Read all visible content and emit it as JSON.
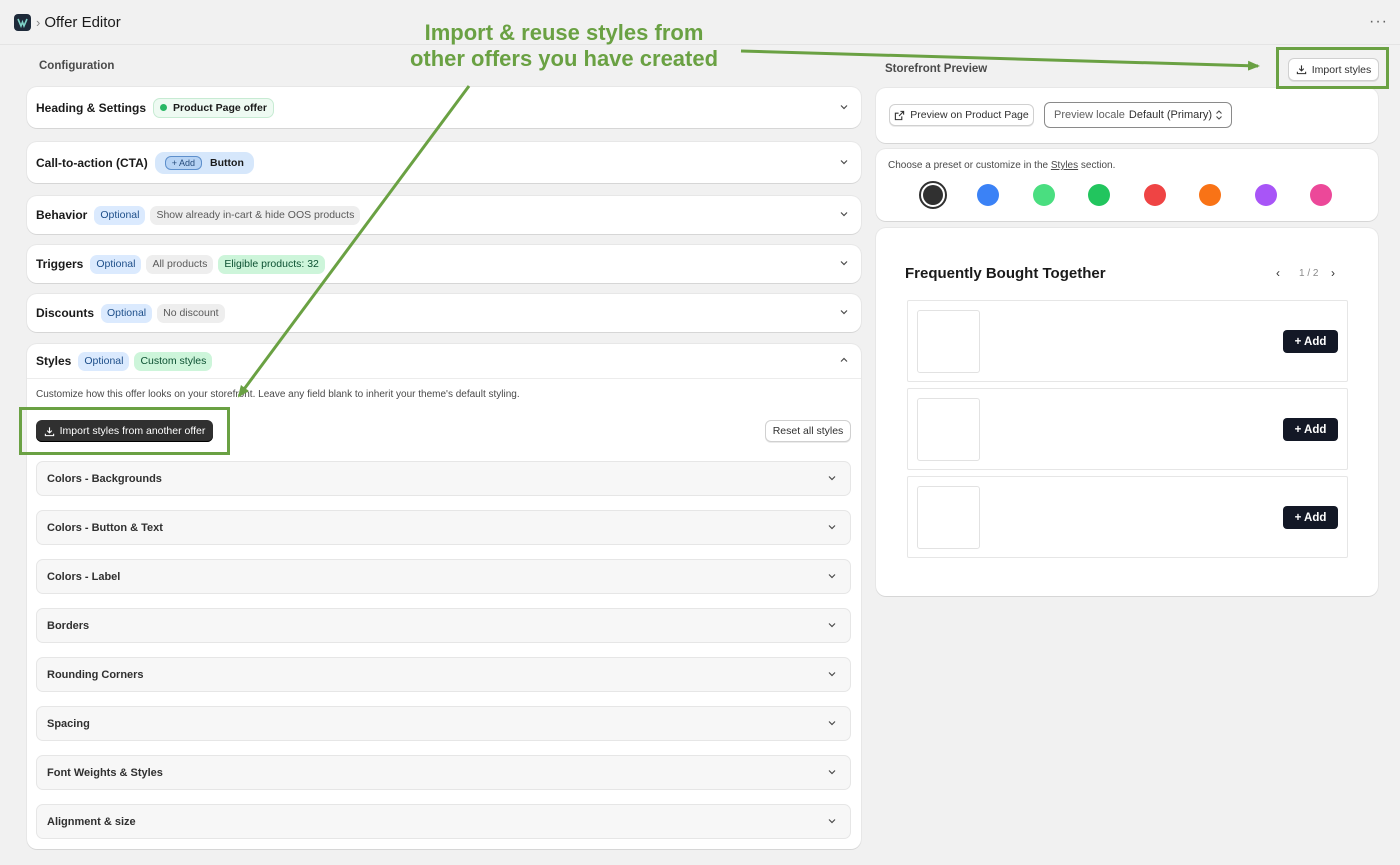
{
  "header": {
    "title": "Offer Editor",
    "separator": "›",
    "more": "···"
  },
  "annotation": {
    "line1": "Import & reuse styles from",
    "line2": "other offers you have created"
  },
  "config": {
    "title": "Configuration",
    "sections": {
      "heading": {
        "label": "Heading & Settings",
        "badge": "Product Page offer"
      },
      "cta": {
        "label": "Call-to-action (CTA)",
        "mini": "+ Add",
        "badge": "Button"
      },
      "behavior": {
        "label": "Behavior",
        "optional": "Optional",
        "detail": "Show already in-cart & hide OOS products"
      },
      "triggers": {
        "label": "Triggers",
        "optional": "Optional",
        "detail": "All products",
        "eligible": "Eligible products: 32"
      },
      "discounts": {
        "label": "Discounts",
        "optional": "Optional",
        "detail": "No discount"
      },
      "styles": {
        "label": "Styles",
        "optional": "Optional",
        "custom": "Custom styles",
        "description": "Customize how this offer looks on your storefront. Leave any field blank to inherit your theme's default styling.",
        "import_button": "Import styles from another offer",
        "reset_button": "Reset all styles",
        "subsections": [
          "Colors - Backgrounds",
          "Colors - Button & Text",
          "Colors - Label",
          "Borders",
          "Rounding Corners",
          "Spacing",
          "Font Weights & Styles",
          "Alignment & size"
        ]
      }
    }
  },
  "preview": {
    "title": "Storefront Preview",
    "import_button": "Import styles",
    "product_page_button": "Preview on Product Page",
    "locale_label": "Preview locale",
    "locale_value": "Default (Primary)",
    "preset_text_before": "Choose a preset or customize in the ",
    "preset_link": "Styles",
    "preset_text_after": " section.",
    "swatches": [
      "#303030",
      "#3b82f6",
      "#4ade80",
      "#22c55e",
      "#ef4444",
      "#f97316",
      "#a855f7",
      "#ec4899"
    ],
    "widget": {
      "title": "Frequently Bought Together",
      "page": "1 / 2",
      "add_label": "+ Add"
    }
  },
  "colors": {
    "annotation": "#6aa143",
    "primary_button": "#303030"
  }
}
